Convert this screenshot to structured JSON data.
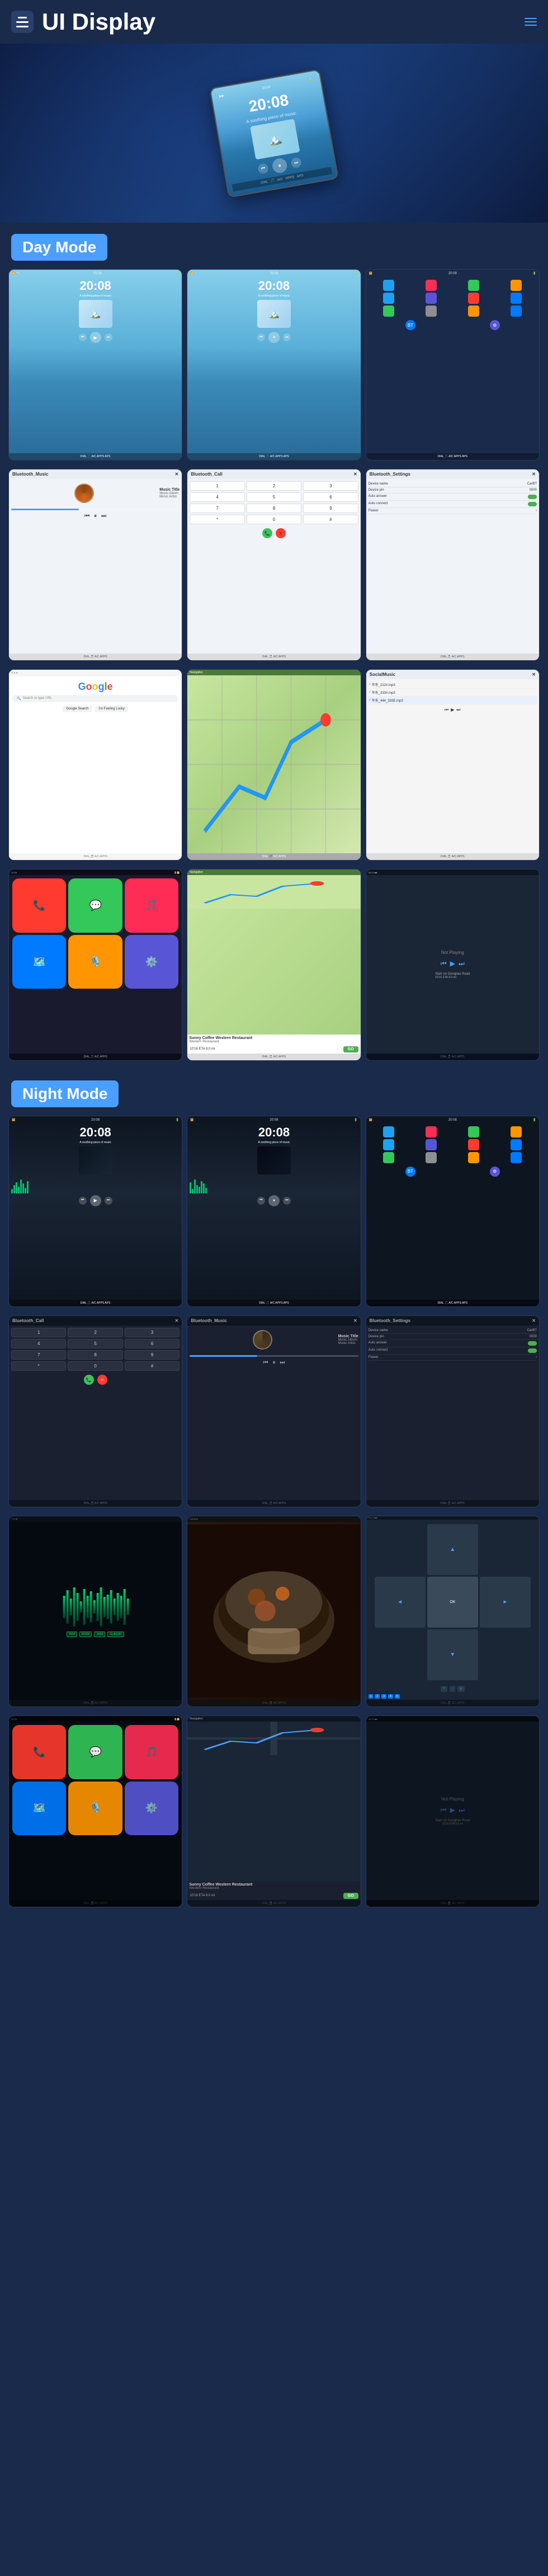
{
  "header": {
    "title": "UI Display",
    "menu_label": "menu",
    "nav_label": "navigation"
  },
  "sections": {
    "day_mode": "Day Mode",
    "night_mode": "Night Mode"
  },
  "screens": {
    "time": "20:08",
    "subtitle": "A soothing piece of music",
    "music_title": "Music Title",
    "music_album": "Music Album",
    "music_artist": "Music Artist",
    "bluetooth_music": "Bluetooth_Music",
    "bluetooth_call": "Bluetooth_Call",
    "bluetooth_settings": "Bluetooth_Settings",
    "local_music": "SocialMusic",
    "device_name_label": "Device name",
    "device_name_value": "CarBT",
    "device_pin_label": "Device pin",
    "device_pin_value": "0000",
    "auto_answer_label": "Auto answer",
    "auto_connect_label": "Auto connect",
    "flower_label": "Flower",
    "restaurant_name": "Sunny Coffee Western Restaurant",
    "restaurant_subtitle": "Western Restaurant",
    "eta_label": "10'16 ETA  9.0 mi",
    "go_label": "GO",
    "not_playing": "Not Playing",
    "start_on": "Start on Dongliao Road",
    "google_search_placeholder": "Search or type URL"
  },
  "colors": {
    "accent_blue": "#4a9fff",
    "day_sky": "#87ceeb",
    "night_bg": "#0d1520",
    "section_bg": "#4a9fff",
    "green": "#00ff88",
    "red": "#FF3B30",
    "orange": "#FF9500",
    "purple": "#AF52DE"
  },
  "app_icons": {
    "phone": "📞",
    "music": "🎵",
    "maps": "🗺️",
    "settings": "⚙️",
    "messages": "💬",
    "bluetooth": "📶",
    "radio": "📻",
    "camera": "📷"
  }
}
